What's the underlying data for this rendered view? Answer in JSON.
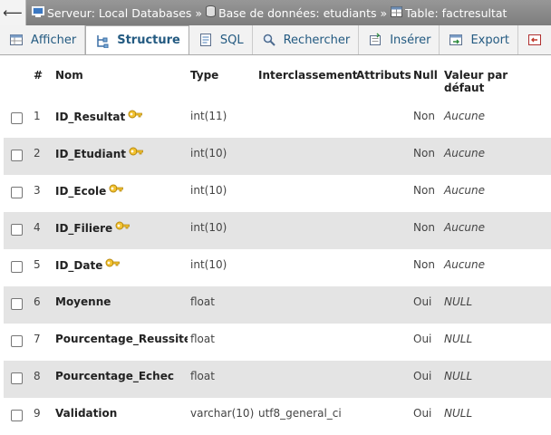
{
  "breadcrumb": {
    "server": "Serveur: Local Databases",
    "database": "Base de données: etudiants",
    "table": "Table: factresultat"
  },
  "tabs": [
    {
      "label": "Afficher",
      "icon": "browse-icon"
    },
    {
      "label": "Structure",
      "icon": "structure-icon"
    },
    {
      "label": "SQL",
      "icon": "sql-icon"
    },
    {
      "label": "Rechercher",
      "icon": "search-icon"
    },
    {
      "label": "Insérer",
      "icon": "insert-icon"
    },
    {
      "label": "Export",
      "icon": "export-icon"
    }
  ],
  "columns": {
    "num": "#",
    "nom": "Nom",
    "type": "Type",
    "collation": "Interclassement",
    "attributes": "Attributs",
    "null": "Null",
    "default": "Valeur par défaut"
  },
  "rows": [
    {
      "num": "1",
      "nom": "ID_Resultat",
      "key": true,
      "type": "int(11)",
      "collation": "",
      "null": "Non",
      "default": "Aucune"
    },
    {
      "num": "2",
      "nom": "ID_Etudiant",
      "key": true,
      "type": "int(10)",
      "collation": "",
      "null": "Non",
      "default": "Aucune"
    },
    {
      "num": "3",
      "nom": "ID_Ecole",
      "key": true,
      "type": "int(10)",
      "collation": "",
      "null": "Non",
      "default": "Aucune"
    },
    {
      "num": "4",
      "nom": "ID_Filiere",
      "key": true,
      "type": "int(10)",
      "collation": "",
      "null": "Non",
      "default": "Aucune"
    },
    {
      "num": "5",
      "nom": "ID_Date",
      "key": true,
      "type": "int(10)",
      "collation": "",
      "null": "Non",
      "default": "Aucune"
    },
    {
      "num": "6",
      "nom": "Moyenne",
      "key": false,
      "type": "float",
      "collation": "",
      "null": "Oui",
      "default": "NULL"
    },
    {
      "num": "7",
      "nom": "Pourcentage_Reussite",
      "key": false,
      "type": "float",
      "collation": "",
      "null": "Oui",
      "default": "NULL"
    },
    {
      "num": "8",
      "nom": "Pourcentage_Echec",
      "key": false,
      "type": "float",
      "collation": "",
      "null": "Oui",
      "default": "NULL"
    },
    {
      "num": "9",
      "nom": "Validation",
      "key": false,
      "type": "varchar(10)",
      "collation": "utf8_general_ci",
      "null": "Oui",
      "default": "NULL"
    }
  ]
}
